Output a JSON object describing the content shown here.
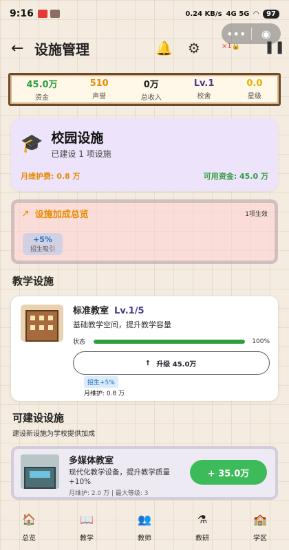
{
  "statusbar": {
    "time": "9:16",
    "battery": "97",
    "network": "0.24 KB/s",
    "signal": "4G 5G"
  },
  "header": {
    "back_icon": "arrow-left-icon",
    "title": "设施管理",
    "badge": "×1🔒"
  },
  "stats": [
    {
      "value": "45.0万",
      "label": "资金",
      "color": "#2e9e3e"
    },
    {
      "value": "510",
      "label": "声誉",
      "color": "#e88a00"
    },
    {
      "value": "0万",
      "label": "总收入",
      "color": "#222222"
    },
    {
      "value": "Lv.1",
      "label": "校舍",
      "color": "#4a3a8c"
    },
    {
      "value": "0.0",
      "label": "星级",
      "color": "#e8b000"
    }
  ],
  "hero": {
    "title": "校园设施",
    "subtitle": "已建设 1 项设施",
    "monthly_upkeep": "月维护费: 0.8 万",
    "available_funds": "可用资金: 45.0 万"
  },
  "overview": {
    "title": "设施加成总览",
    "count": "1项生效",
    "bonus_value": "+5%",
    "bonus_label": "招生吸引"
  },
  "teaching": {
    "section_title": "教学设施",
    "facility": {
      "name": "标准教室",
      "level": "Lv.1/5",
      "description": "基础教学空间，提升教学容量",
      "status_label": "状态",
      "status_percent": "100%",
      "status_fraction": 1.0,
      "upgrade_label": "升级 45.0万",
      "tag": "招生+5%",
      "maintenance": "月维护: 0.8 万"
    }
  },
  "buildable": {
    "section_title": "可建设设施",
    "section_subtitle": "建设新设施为学校提供加成",
    "facility": {
      "name": "多媒体教室",
      "description": "现代化教学设备，提升教学质量+10%",
      "meta": "月维护: 2.0 万 | 最大等级: 3",
      "build_label": "+ 35.0万"
    }
  },
  "tabs": [
    {
      "label": "总览",
      "icon": "school-house-icon"
    },
    {
      "label": "教学",
      "icon": "book-icon"
    },
    {
      "label": "教师",
      "icon": "teachers-icon"
    },
    {
      "label": "教研",
      "icon": "flask-icon"
    },
    {
      "label": "学区",
      "icon": "district-icon"
    }
  ]
}
